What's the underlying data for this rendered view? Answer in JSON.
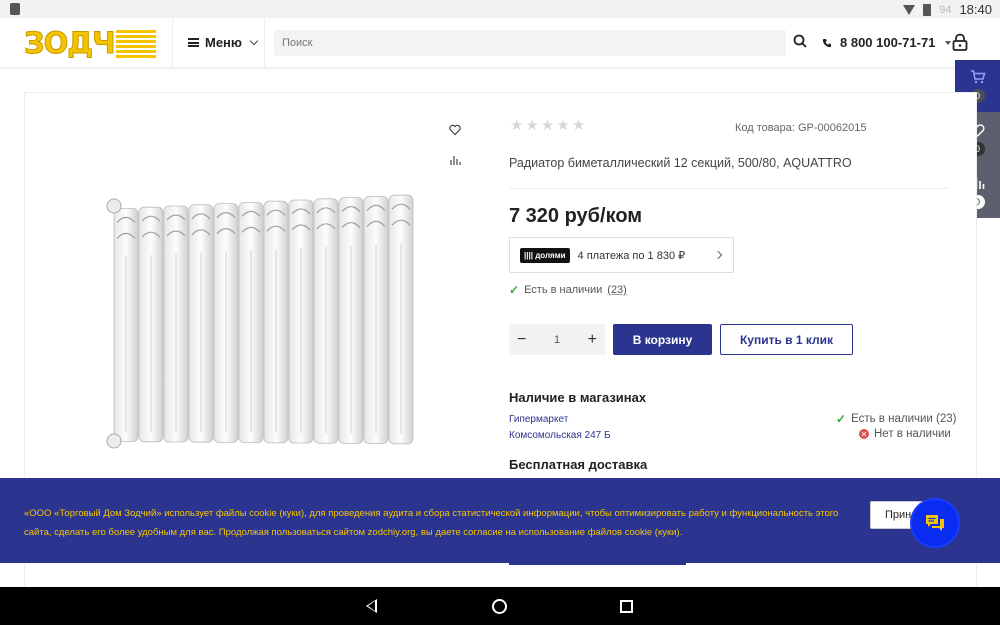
{
  "status_bar": {
    "battery_pct": "94",
    "time": "18:40"
  },
  "header": {
    "logo_text": "ЗОДЧ",
    "menu_label": "Меню",
    "search_placeholder": "Поиск",
    "phone": "8 800 100-71-71"
  },
  "side_panel": {
    "cart_count": "0",
    "favorites_count": "0",
    "compare_count": "0"
  },
  "product": {
    "rating_stars": 0,
    "sku_label": "Код товара: GP-00062015",
    "title": "Радиатор биметаллический 12 секций, 500/80, AQUATTRO",
    "price": "7 320 руб/ком",
    "installments_logo": "долями",
    "installments_text": "4 платежа по 1 830 ₽",
    "availability_label": "Есть в наличии",
    "availability_count": "(23)",
    "quantity": "1",
    "minus": "−",
    "plus": "+",
    "add_to_cart": "В корзину",
    "buy_one_click": "Купить в 1 клик"
  },
  "stores": {
    "title": "Наличие в магазинах",
    "store_type": "Гипермаркет",
    "store_address": "Комсомольская 247 Б",
    "status_in_stock": "Есть в наличии (23)",
    "status_out_of_stock": "Нет в наличии"
  },
  "delivery": {
    "title": "Бесплатная доставка"
  },
  "cookie": {
    "text": "«ООО «Торговый Дом Зодчий» использует файлы cookie (куки), для проведения аудита и сбора статистической информации, чтобы оптимизировать работу и функциональность этого сайта, сделать его более удобным для вас. Продолжая пользоваться сайтом zodchiy.org, вы даете согласие на использование файлов cookie (куки).",
    "accept_label": "Принять"
  },
  "colors": {
    "brand": "#2b3590",
    "accent": "#f5c400",
    "chat": "#0a2cf0"
  }
}
